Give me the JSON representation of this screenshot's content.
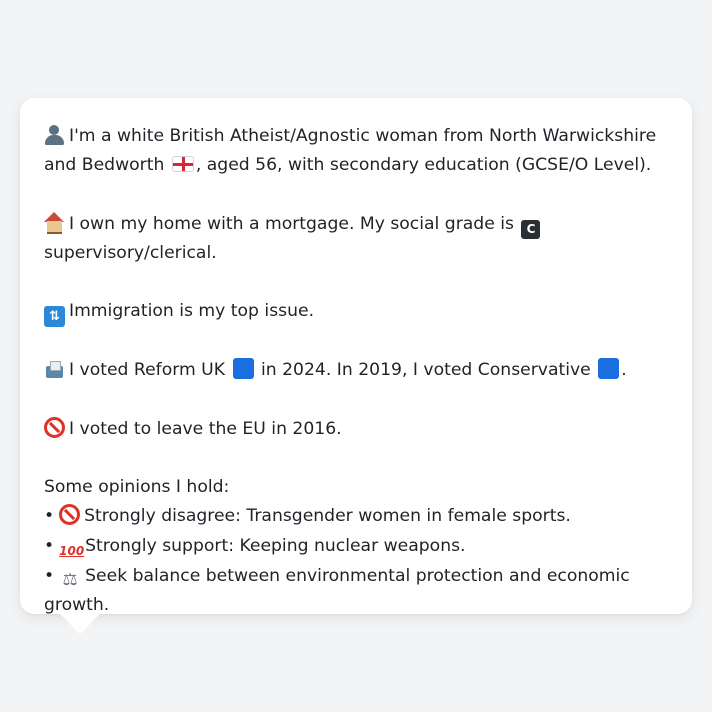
{
  "profile": {
    "identity": {
      "icon": "bust-icon",
      "text_1": "I'm a white British Atheist/Agnostic woman from North Warwickshire and Bedworth",
      "flag_icon": "england-flag-icon",
      "text_2": ", aged 56, with secondary education (GCSE/O Level)."
    },
    "housing": {
      "icon": "house-icon",
      "text_1": "I own my home with a mortgage. My social grade is",
      "grade_glyph": "C",
      "text_2": " supervisory/clerical."
    },
    "top_issue": {
      "icon": "immigration-arrows-icon",
      "glyph": "⇅",
      "text": "Immigration is my top issue."
    },
    "votes": {
      "icon": "ballot-box-icon",
      "text_1": "I voted Reform UK",
      "party_square_1": "blue-square-icon",
      "text_2": " in 2024. In 2019, I voted Conservative",
      "party_square_2": "blue-square-icon",
      "text_3": ".",
      "square_color": "#1a6fe0"
    },
    "brexit": {
      "icon": "no-entry-icon",
      "text": "I voted to leave the EU in 2016."
    },
    "opinions": {
      "heading": "Some opinions I hold:",
      "bullet": "•",
      "items": [
        {
          "icon": "no-entry-icon",
          "glyph": "",
          "text": "Strongly disagree: Transgender women in female sports."
        },
        {
          "icon": "hundred-points-icon",
          "glyph": "100",
          "text": "Strongly support: Keeping nuclear weapons."
        },
        {
          "icon": "balance-scale-icon",
          "glyph": "⚖",
          "text": "Seek balance between environmental protection and economic growth."
        }
      ]
    }
  },
  "colors": {
    "background": "#f3f4f6",
    "bubble": "#ffffff",
    "text": "#1f2328",
    "accent_red": "#e0302a"
  }
}
